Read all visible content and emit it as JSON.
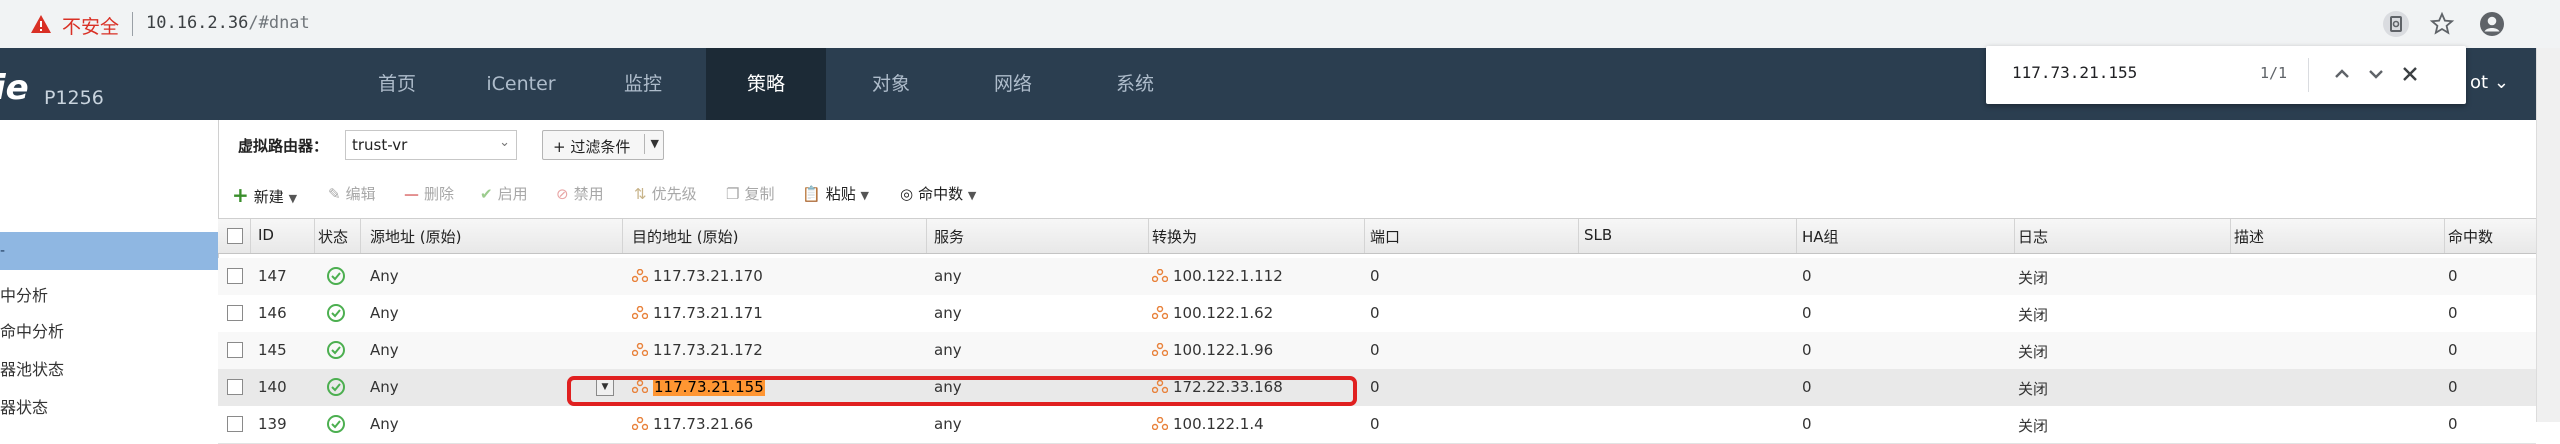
{
  "browser": {
    "security_label": "不安全",
    "url_host": "10.16.2.36",
    "url_path": "/#dnat",
    "icons": [
      "page-info-icon",
      "star-icon",
      "account-icon"
    ]
  },
  "app": {
    "logo": "ie",
    "model": "P1256",
    "nav": [
      "首页",
      "iCenter",
      "监控",
      "策略",
      "对象",
      "网络",
      "系统"
    ],
    "active_nav": "策略",
    "user_menu": "ot"
  },
  "find_bar": {
    "query": "117.73.21.155",
    "count": "1/1"
  },
  "sidebar": {
    "items": [
      "中分析",
      "命中分析",
      "器池状态",
      "器状态"
    ]
  },
  "filter": {
    "vr_label": "虚拟路由器：",
    "vr_value": "trust-vr",
    "filter_button": "+ 过滤条件"
  },
  "toolbar": {
    "new": "新建",
    "edit": "编辑",
    "delete": "删除",
    "enable": "启用",
    "disable": "禁用",
    "priority": "优先级",
    "copy": "复制",
    "paste": "粘贴",
    "hit_count": "命中数"
  },
  "table": {
    "columns": [
      "ID",
      "状态",
      "源地址 (原始)",
      "目的地址 (原始)",
      "服务",
      "转换为",
      "端口",
      "SLB",
      "HA组",
      "日志",
      "描述",
      "命中数"
    ],
    "rows": [
      {
        "id": "147",
        "src": "Any",
        "dst": "117.73.21.170",
        "service": "any",
        "to": "100.122.1.112",
        "port": "0",
        "slb": "",
        "ha": "0",
        "log": "关闭",
        "desc": "",
        "hits": "0"
      },
      {
        "id": "146",
        "src": "Any",
        "dst": "117.73.21.171",
        "service": "any",
        "to": "100.122.1.62",
        "port": "0",
        "slb": "",
        "ha": "0",
        "log": "关闭",
        "desc": "",
        "hits": "0"
      },
      {
        "id": "145",
        "src": "Any",
        "dst": "117.73.21.172",
        "service": "any",
        "to": "100.122.1.96",
        "port": "0",
        "slb": "",
        "ha": "0",
        "log": "关闭",
        "desc": "",
        "hits": "0"
      },
      {
        "id": "140",
        "src": "Any",
        "dst": "117.73.21.155",
        "service": "any",
        "to": "172.22.33.168",
        "port": "0",
        "slb": "",
        "ha": "0",
        "log": "关闭",
        "desc": "",
        "hits": "0"
      },
      {
        "id": "139",
        "src": "Any",
        "dst": "117.73.21.66",
        "service": "any",
        "to": "100.122.1.4",
        "port": "0",
        "slb": "",
        "ha": "0",
        "log": "关闭",
        "desc": "",
        "hits": "0"
      }
    ]
  },
  "colors": {
    "nav_bg": "#2b3e50",
    "nav_active_bg": "#1c2a36",
    "sidebar_active": "#8fb7e2",
    "find_highlight": "#ff9632",
    "annotation_red": "#e02020",
    "status_ok": "#4caf50",
    "address_icon": "#e8813a"
  }
}
